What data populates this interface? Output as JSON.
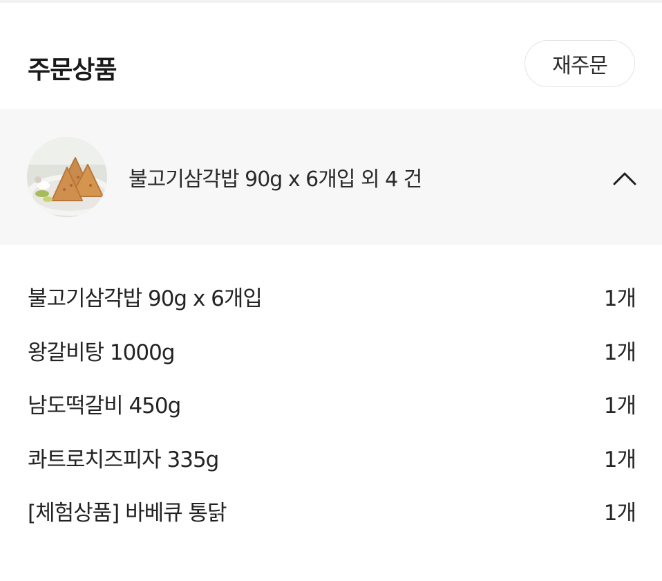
{
  "header": {
    "title": "주문상품",
    "reorder_label": "재주문"
  },
  "summary": {
    "text": "불고기삼각밥 90g x 6개입 외 4 건",
    "toggle_icon": "chevron-up-icon"
  },
  "items": [
    {
      "name": "불고기삼각밥 90g x 6개입",
      "qty": "1개"
    },
    {
      "name": "왕갈비탕 1000g",
      "qty": "1개"
    },
    {
      "name": "남도떡갈비 450g",
      "qty": "1개"
    },
    {
      "name": "콰트로치즈피자 335g",
      "qty": "1개"
    },
    {
      "name": "[체험상품] 바베큐 통닭",
      "qty": "1개"
    }
  ],
  "colors": {
    "summary_background": "#f7f7f7",
    "button_border": "#e3e3e3",
    "text": "#232323"
  }
}
